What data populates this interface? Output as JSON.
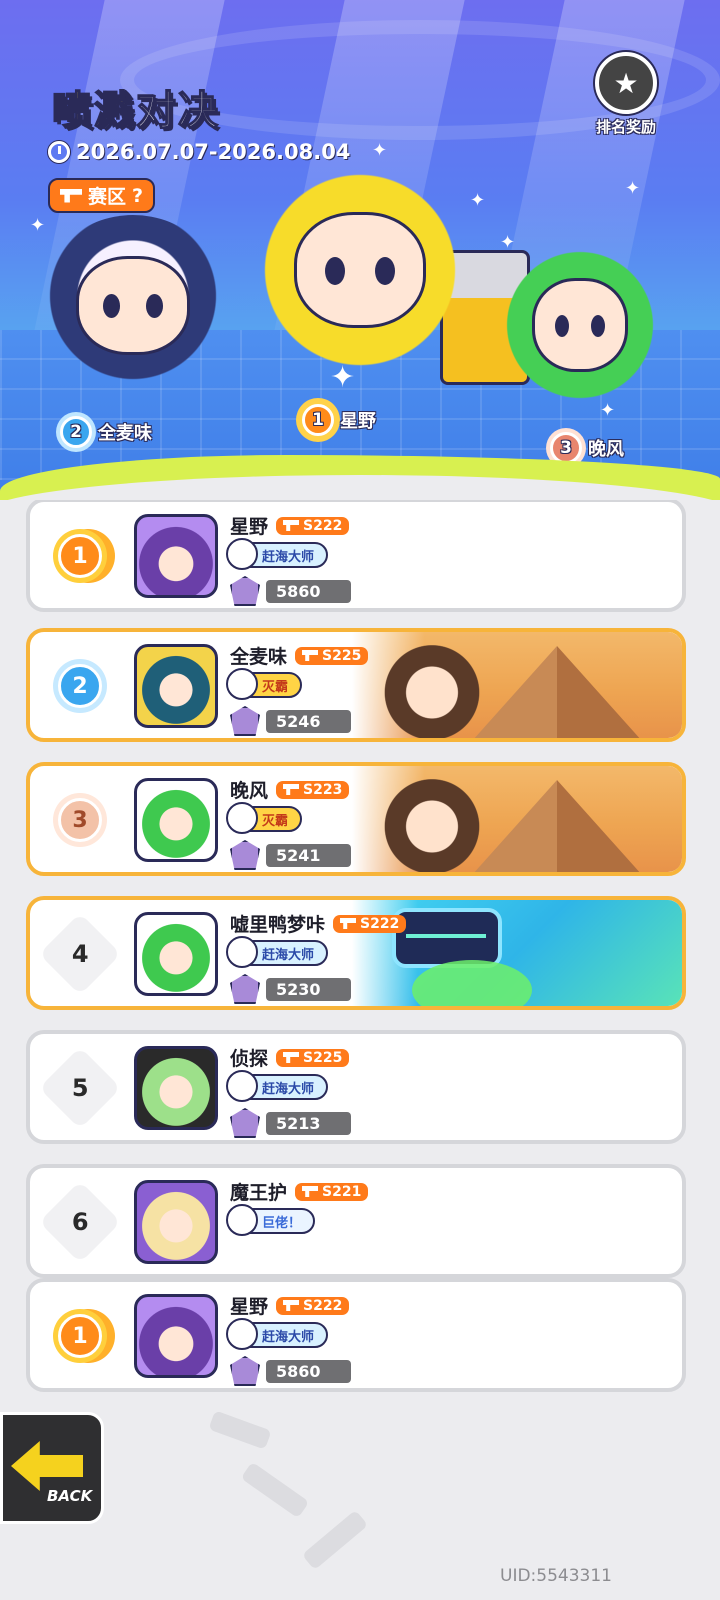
{
  "header": {
    "title_part1": "喷溅",
    "title_part2": "对决",
    "date_range": "2026.07.07-2026.08.04",
    "region_label": "赛区",
    "region_help": "?",
    "rank_reward_label": "排名奖励"
  },
  "podium": [
    {
      "rank": "2",
      "name": "全麦味"
    },
    {
      "rank": "1",
      "name": "星野"
    },
    {
      "rank": "3",
      "name": "晚风"
    }
  ],
  "leaderboard": [
    {
      "rank": "1",
      "name": "星野",
      "season": "S222",
      "title": "赶海大师",
      "score": "5860",
      "banner": "none"
    },
    {
      "rank": "2",
      "name": "全麦味",
      "season": "S225",
      "title": "灭霸",
      "score": "5246",
      "banner": "desert"
    },
    {
      "rank": "3",
      "name": "晚风",
      "season": "S223",
      "title": "灭霸",
      "score": "5241",
      "banner": "desert"
    },
    {
      "rank": "4",
      "name": "嘘里鸭梦咔",
      "season": "S222",
      "title": "赶海大师",
      "score": "5230",
      "banner": "tech"
    },
    {
      "rank": "5",
      "name": "侦探",
      "season": "S225",
      "title": "赶海大师",
      "score": "5213",
      "banner": "none"
    },
    {
      "rank": "6",
      "name": "魔王护",
      "season": "S221",
      "title": "巨佬！",
      "score": "",
      "banner": "none"
    }
  ],
  "my_rank": {
    "rank": "1",
    "name": "星野",
    "season": "S222",
    "title": "赶海大师",
    "score": "5860"
  },
  "footer": {
    "back_label": "BACK",
    "uid": "UID:5543311"
  },
  "colors": {
    "accent_orange": "#ff7a1a",
    "gold_border": "#f7b43a",
    "header_top": "#6d6ef0",
    "slime": "#d8f050"
  }
}
